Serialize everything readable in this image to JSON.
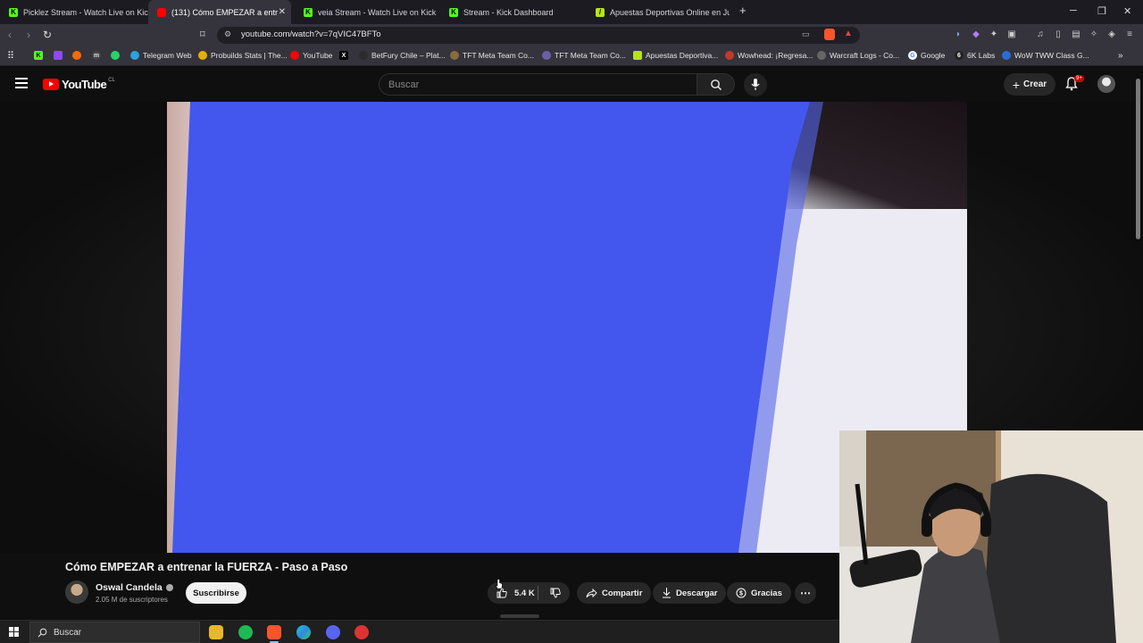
{
  "browser": {
    "tabs": [
      {
        "title": "Picklez Stream - Watch Live on Kick",
        "icon": "kick-icon",
        "active": false
      },
      {
        "title": "(131) Cómo EMPEZAR a entr",
        "icon": "youtube-icon",
        "active": true
      },
      {
        "title": "veia Stream - Watch Live on Kick",
        "icon": "kick-icon",
        "active": false
      },
      {
        "title": "Stream - Kick Dashboard",
        "icon": "kick-icon",
        "active": false
      },
      {
        "title": "Apuestas Deportivas Online en Jugal",
        "icon": "betting-icon",
        "active": false
      }
    ],
    "url": "youtube.com/watch?v=7qVIC47BFTo",
    "bookmarks": [
      "Telegram Web",
      "Probuilds Stats | The...",
      "YouTube",
      "BetFury Chile – Plat...",
      "TFT Meta Team Co...",
      "TFT Meta Team Co...",
      "Apuestas Deportiva...",
      "Wowhead: ¡Regresa...",
      "Warcraft Logs - Co...",
      "Google",
      "6K Labs",
      "WoW TWW Class G..."
    ]
  },
  "youtube": {
    "logo_text": "YouTube",
    "country_code": "CL",
    "search_placeholder": "Buscar",
    "create_label": "Crear",
    "notifications_badge": "9+"
  },
  "video": {
    "title": "Cómo EMPEZAR a entrenar la FUERZA - Paso a Paso",
    "channel_name": "Oswal Candela",
    "subscribers": "2.05 M de suscriptores",
    "subscribe_label": "Suscribirse",
    "likes": "5.4 K",
    "share_label": "Compartir",
    "download_label": "Descargar",
    "thanks_label": "Gracias"
  },
  "taskbar": {
    "search_placeholder": "Buscar"
  },
  "colors": {
    "overlay_blue": "#4357ee",
    "youtube_red": "#ff0000",
    "kick_green": "#53fc18"
  }
}
